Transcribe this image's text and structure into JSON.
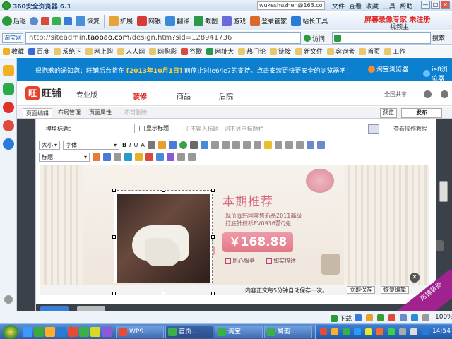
{
  "browser": {
    "title": "360安全浏览器 6.1",
    "account": "wukeshuzhen@163.co",
    "menu": [
      "文件",
      "查看",
      "收藏",
      "工具",
      "帮助"
    ],
    "window_buttons": [
      "—",
      "□",
      "✕"
    ]
  },
  "toolbar": {
    "back": "后退",
    "restore": "恢复",
    "extend": "扩展",
    "netbank": "网银",
    "translate": "翻译",
    "screenshot": "截图",
    "games": "游戏",
    "login_manager": "登录管家",
    "webmaster": "站长工具",
    "watermark_top": "屏幕录像专家  未注册",
    "watermark_sub": "视频主"
  },
  "address": {
    "site_badge": "淘宝网",
    "url_prefix": "http://siteadmin.",
    "url_domain": "taobao.com",
    "url_suffix": "/design.htm?sid=128941736",
    "go_label": "访问",
    "search_btn": "搜索"
  },
  "favorites": [
    "收藏",
    "百度",
    "系统下",
    "网上购",
    "人人网",
    "网购彩",
    "谷歌",
    "网址大",
    "热门论",
    "链接",
    "新文件",
    "容询者",
    "首页",
    "工作"
  ],
  "notice": {
    "prefix": "很抱歉的通知您：旺铺后台将在",
    "date": "[2013年10月1日]",
    "suffix": "前停止对ie6/ie7的支持。点击安装更快更安全的浏览器吧！",
    "browser1": "淘宝浏览器",
    "browser2": "ie8浏览器"
  },
  "wangpu": {
    "logo_mark": "旺",
    "logo_text": "旺铺",
    "version": "专业版",
    "nav": [
      "装修",
      "商品",
      "后院"
    ],
    "share": "全国共享"
  },
  "edit_tabs": {
    "tabs": [
      "页面编辑",
      "布局管理",
      "页面属性",
      "不可删除"
    ],
    "preview": "预览",
    "publish": "发布"
  },
  "editor": {
    "module_title_label": "模块标题：",
    "show_title_label": "显示标题",
    "title_hint": "（ 不输入标题，则不显示标题栏",
    "help": "查看操作教程",
    "size_select": "大小",
    "font_select": "字体",
    "heading_select": "标题",
    "autosave": "内容正文每5分钟自动保存一次。",
    "save_now": "立即保存",
    "restore_draft": "恢复编辑"
  },
  "promo": {
    "title": "本期推荐",
    "line1": "现价@韩国零售新品2011高级",
    "line2": "打底针织衫EV0936蕾Q兔",
    "price": "￥168.88",
    "check1": "用心服务",
    "check2": "如实描述"
  },
  "badge": {
    "close": "✕",
    "text": "店铺装修"
  },
  "statusbar": {
    "download": "下载",
    "zoom": "100%"
  },
  "taskbar": {
    "tasks": [
      "WPS...",
      "首页...",
      "淘宝...",
      "蜀韵..."
    ],
    "clock": "14:54"
  },
  "colors": {
    "accent_blue": "#0d7fcf",
    "wangpu_red": "#e7432c",
    "promo_pink": "#e27888",
    "badge_purple": "#a0228f"
  }
}
